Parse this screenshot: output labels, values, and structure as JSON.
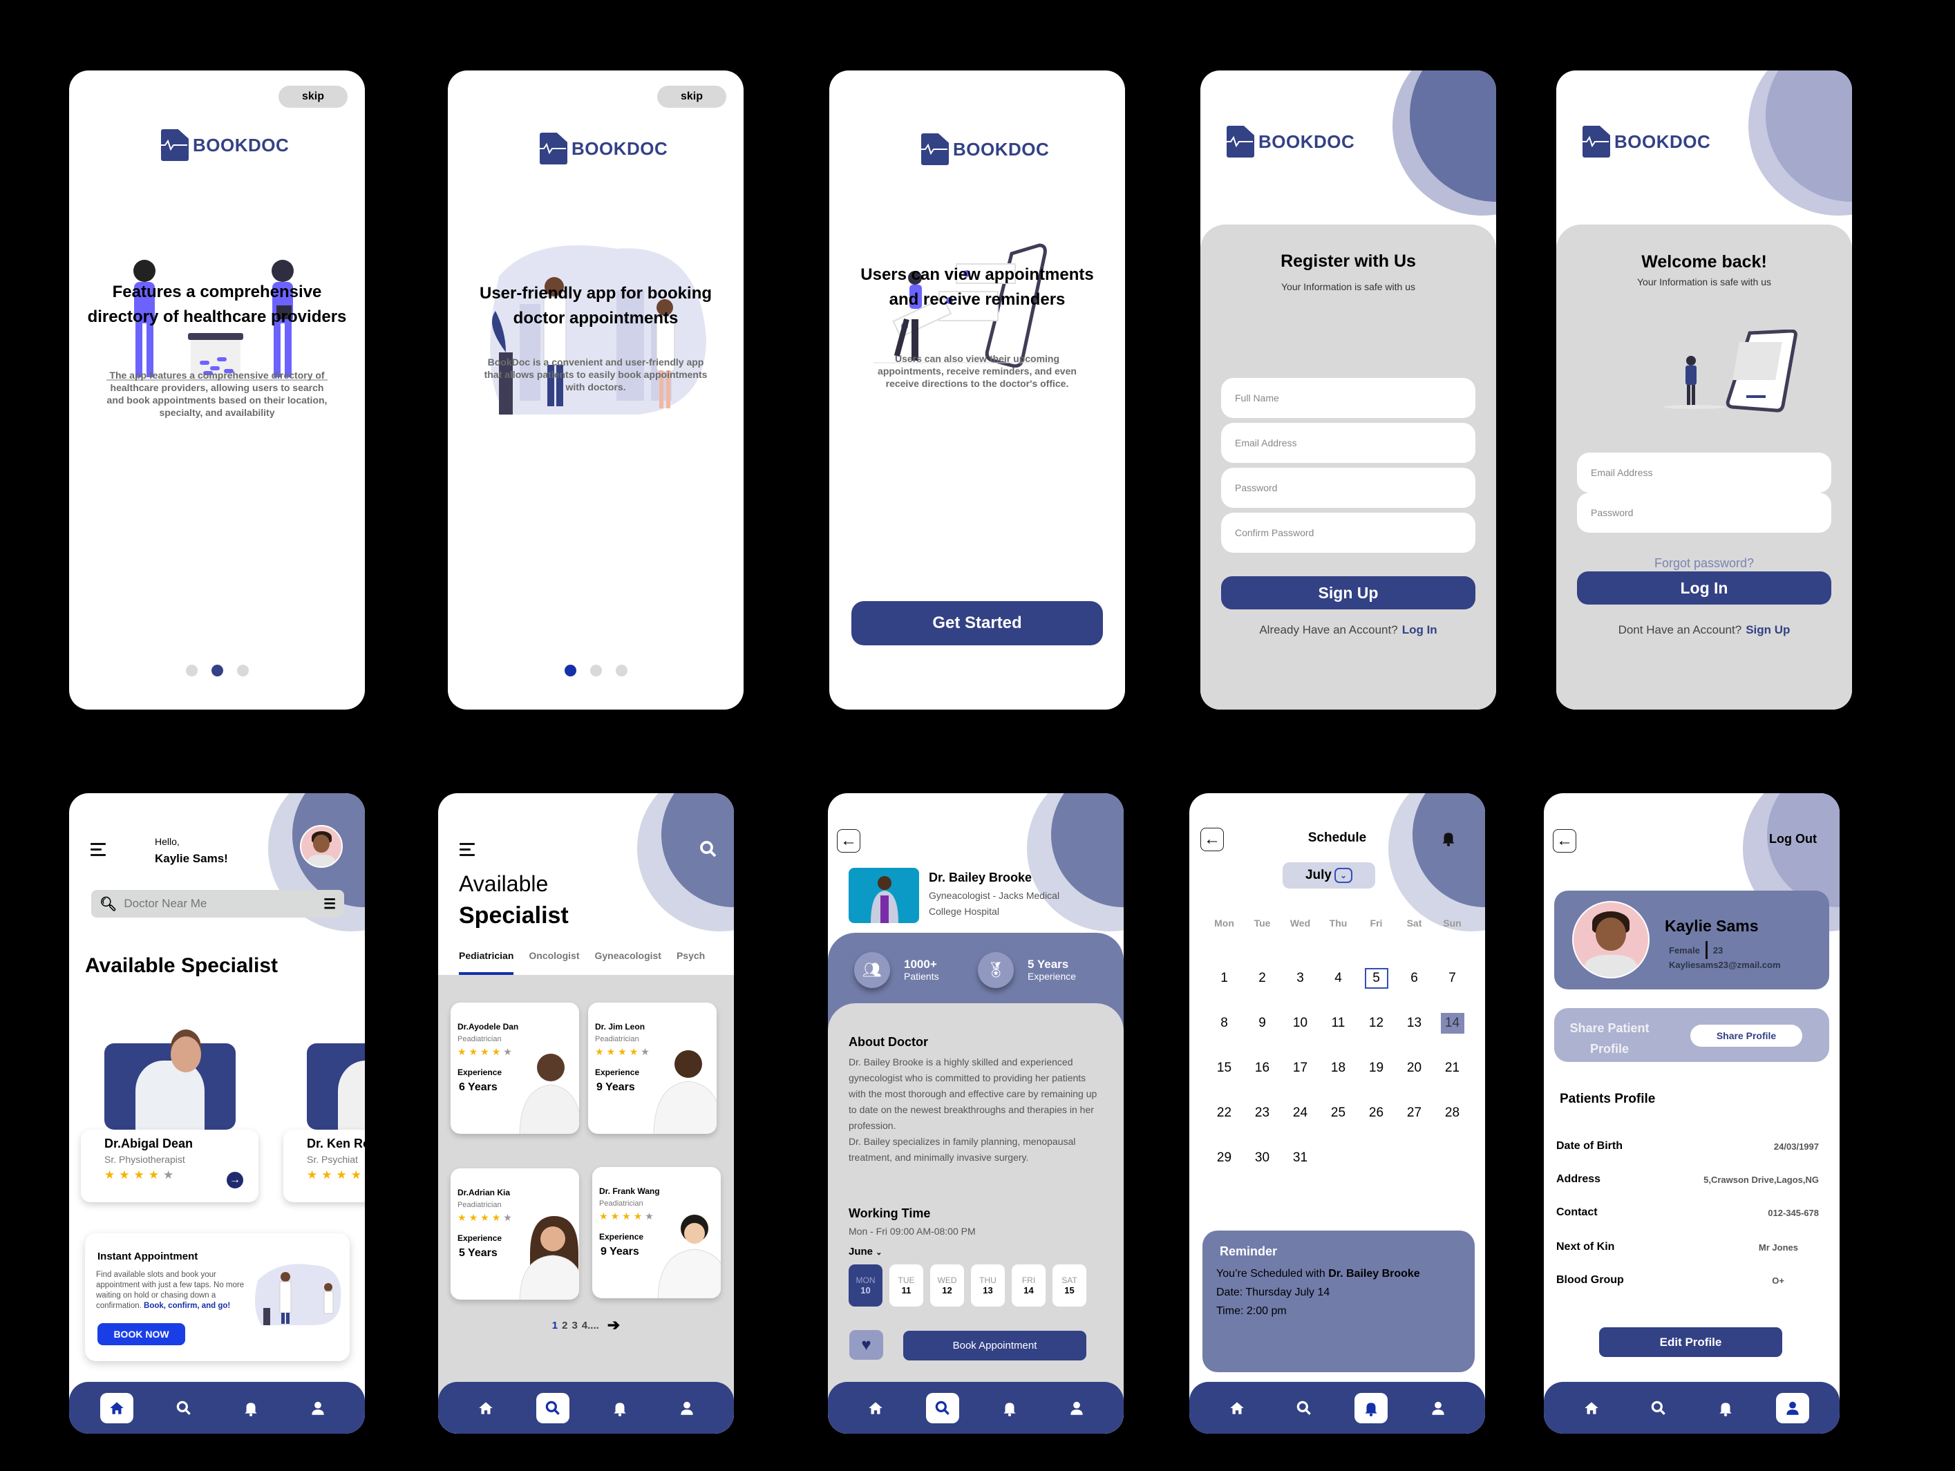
{
  "brand": {
    "name": "BOOKDOC",
    "primary_color": "#334185",
    "accent_light": "#717ca9"
  },
  "onboarding": [
    {
      "skip_label": "skip",
      "headline": "Features a comprehensive directory of healthcare providers",
      "body": "The app features a comprehensive directory of healthcare providers, allowing users to search and book appointments based on their location, specialty, and availability",
      "page_index": 2,
      "page_count": 3
    },
    {
      "skip_label": "skip",
      "headline": "User-friendly app for booking doctor appointments",
      "body": "BookDoc is a convenient and user-friendly app that allows patients to easily book appointments with doctors.",
      "page_index": 1,
      "page_count": 3
    },
    {
      "headline": "Users can view appointments and receive reminders",
      "body": "Users can also view their upcoming appointments, receive reminders, and even receive directions to the doctor's office.",
      "cta": "Get Started"
    }
  ],
  "register": {
    "title": "Register with Us",
    "subtitle": "Your Information is safe with us",
    "fields": {
      "full_name": "Full Name",
      "email": "Email Address",
      "password": "Password",
      "confirm_password": "Confirm Password"
    },
    "submit": "Sign Up",
    "footer_text": "Already Have an Account?",
    "footer_link": "Log In"
  },
  "login": {
    "title": "Welcome back!",
    "subtitle": "Your Information is safe with us",
    "fields": {
      "email": "Email Address",
      "password": "Password"
    },
    "forgot": "Forgot password?",
    "submit": "Log In",
    "footer_text": "Dont Have an Account?",
    "footer_link": "Sign Up"
  },
  "home": {
    "greeting": "Hello,",
    "user_name": "Kaylie Sams!",
    "search_placeholder": "Doctor Near Me",
    "section_title": "Available Specialist",
    "specialists": [
      {
        "name": "Dr.Abigal Dean",
        "role": "Sr. Physiotherapist",
        "rating": 4
      },
      {
        "name": "Dr. Ken Ro",
        "role": "Sr. Psychiat",
        "rating": 4
      }
    ],
    "instant": {
      "title": "Instant Appointment",
      "text": "Find available slots and book your appointment with just a few taps. No more waiting on hold or chasing down a confirmation.",
      "highlight": "Book, confirm, and go!",
      "button": "BOOK NOW"
    }
  },
  "specialists_page": {
    "title_line1": "Available",
    "title_line2": "Specialist",
    "tabs": [
      "Pediatrician",
      "Oncologist",
      "Gyneacologist",
      "Psych"
    ],
    "active_tab": 0,
    "experience_label": "Experience",
    "doctors": [
      {
        "name": "Dr.Ayodele Dan",
        "role": "Peadiatrician",
        "rating": 4,
        "experience": "6 Years"
      },
      {
        "name": "Dr. Jim Leon",
        "role": "Peadiatrician",
        "rating": 4,
        "experience": "9 Years"
      },
      {
        "name": "Dr.Adrian Kia",
        "role": "Peadiatrician",
        "rating": 4,
        "experience": "5 Years"
      },
      {
        "name": "Dr. Frank Wang",
        "role": "Peadiatrician",
        "rating": 4,
        "experience": "9 Years"
      }
    ],
    "pages": [
      "1",
      "2",
      "3",
      "4...."
    ],
    "current_page": "1"
  },
  "doctor_detail": {
    "name": "Dr. Bailey Brooke",
    "specialty": "Gyneacologist - Jacks Medical College Hospital",
    "stats": [
      {
        "value": "1000+",
        "label": "Patients"
      },
      {
        "value": "5 Years",
        "label": "Experience"
      }
    ],
    "about_title": "About Doctor",
    "about_text": "Dr. Bailey Brooke is a highly skilled and experienced gynecologist who is committed to providing her patients with the most thorough and effective care by remaining up to date on the newest breakthroughs and therapies in her profession.",
    "about_text2": "Dr. Bailey specializes in family planning, menopausal treatment, and minimally invasive surgery.",
    "working_title": "Working Time",
    "working_hours": "Mon - Fri 09:00 AM-08:00 PM",
    "month": "June",
    "days": [
      {
        "wd": "MON",
        "d": "10"
      },
      {
        "wd": "TUE",
        "d": "11"
      },
      {
        "wd": "WED",
        "d": "12"
      },
      {
        "wd": "THU",
        "d": "13"
      },
      {
        "wd": "FRI",
        "d": "14"
      },
      {
        "wd": "SAT",
        "d": "15"
      }
    ],
    "selected_day": "10",
    "book_button": "Book Appointment"
  },
  "schedule": {
    "title": "Schedule",
    "month": "July",
    "weekdays": [
      "Mon",
      "Tue",
      "Wed",
      "Thu",
      "Fri",
      "Sat",
      "Sun"
    ],
    "day_count": 31,
    "today": 5,
    "selected": 14,
    "reminder": {
      "title": "Reminder",
      "line1_prefix": "You’re Scheduled with",
      "doctor": "Dr. Bailey Brooke",
      "date": "Date: Thursday July 14",
      "time": "Time: 2:00 pm"
    }
  },
  "profile": {
    "logout": "Log Out",
    "name": "Kaylie Sams",
    "gender": "Female",
    "age": "23",
    "email": "Kayliesams23@zmail.com",
    "share_label": "Share Patient Profile",
    "share_button": "Share Profile",
    "section_title": "Patients Profile",
    "rows": [
      {
        "k": "Date of Birth",
        "v": "24/03/1997"
      },
      {
        "k": "Address",
        "v": "5,Crawson Drive,Lagos,NG"
      },
      {
        "k": "Contact",
        "v": "012-345-678"
      },
      {
        "k": "Next of Kin",
        "v": "Mr Jones"
      },
      {
        "k": "Blood Group",
        "v": "O+"
      }
    ],
    "edit_button": "Edit Profile"
  },
  "nav": {
    "items": [
      {
        "icon": "home-icon"
      },
      {
        "icon": "search-icon"
      },
      {
        "icon": "bell-icon"
      },
      {
        "icon": "user-icon"
      }
    ]
  }
}
